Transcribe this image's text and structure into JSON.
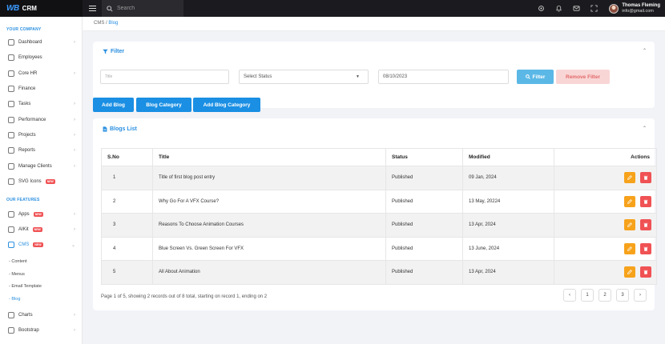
{
  "app": {
    "brand_mark": "WB",
    "brand_name": "CRM"
  },
  "topbar": {
    "search_placeholder": "Search",
    "user": {
      "name": "Thomas Fleming",
      "email": "info@gmail.com"
    }
  },
  "sidebar": {
    "section1": "YOUR COMPANY",
    "items1": [
      {
        "label": "Dashboard",
        "chevron": true
      },
      {
        "label": "Employees"
      },
      {
        "label": "Core HR",
        "chevron": true
      },
      {
        "label": "Finance"
      },
      {
        "label": "Tasks",
        "chevron": true
      },
      {
        "label": "Performance",
        "chevron": true
      },
      {
        "label": "Projects",
        "chevron": true
      },
      {
        "label": "Reports",
        "chevron": true
      },
      {
        "label": "Manage Clients",
        "chevron": true
      },
      {
        "label": "SVG Icons",
        "badge": "NEW"
      }
    ],
    "section2": "OUR FEATURES",
    "items2": [
      {
        "label": "Apps",
        "badge": "NEW",
        "chevron": true
      },
      {
        "label": "AIKit",
        "badge": "NEW",
        "chevron": true
      },
      {
        "label": "CMS",
        "badge": "NEW",
        "chevron": true
      }
    ],
    "cms_sub": [
      "Content",
      "Menus",
      "Email Template",
      "Blog"
    ],
    "items3": [
      {
        "label": "Charts",
        "chevron": true
      },
      {
        "label": "Bootstrap",
        "chevron": true
      }
    ]
  },
  "breadcrumb": {
    "parent": "CMS",
    "sep": "/",
    "current": "Blog"
  },
  "filter": {
    "title": "Filter",
    "title_placeholder": "Title",
    "status_value": "Select Status",
    "date_value": "08/10/2023",
    "filter_button": "Filter",
    "remove_button": "Remove Filter"
  },
  "actions": {
    "add_blog": "Add Blog",
    "blog_category": "Blog Category",
    "add_blog_category": "Add Blog Category"
  },
  "list": {
    "title": "Blogs List",
    "headers": {
      "sno": "S.No",
      "title": "Title",
      "status": "Status",
      "modified": "Modified",
      "actions": "Actions"
    },
    "rows": [
      {
        "sno": "1",
        "title": "Title of first blog post entry",
        "status": "Published",
        "modified": "09 Jan, 2024"
      },
      {
        "sno": "2",
        "title": "Why Go For A VFX Course?",
        "status": "Published",
        "modified": "13 May, 20224"
      },
      {
        "sno": "3",
        "title": "Reasons To Choose Animation Courses",
        "status": "Published",
        "modified": "13 Apr, 2024"
      },
      {
        "sno": "4",
        "title": "Blue Screen Vs. Green Screen For VFX",
        "status": "Published",
        "modified": "13 June, 2024"
      },
      {
        "sno": "5",
        "title": "All About Animation",
        "status": "Published",
        "modified": "13 Apr, 2024"
      }
    ],
    "pager_info": "Page 1 of 5, showing 2 records out of 8 total, starting on record 1, ending on 2",
    "pages": [
      "1",
      "2",
      "3"
    ]
  },
  "colors": {
    "accent": "#2a8fe0",
    "edit": "#f7a21b",
    "delete": "#f05254"
  }
}
